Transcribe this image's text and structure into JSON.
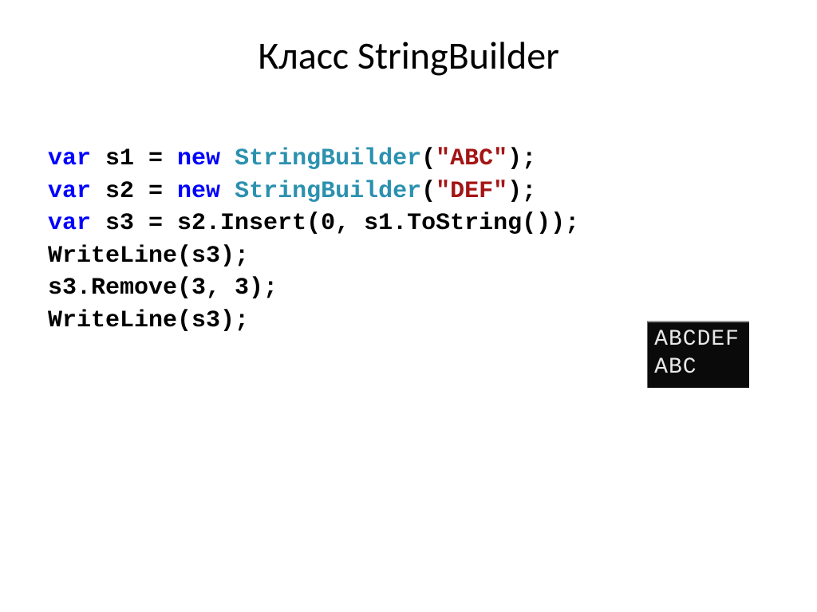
{
  "title": "Класс StringBuilder",
  "code": {
    "line1": {
      "kw_var": "var",
      "ident": " s1 = ",
      "kw_new": "new",
      "sp": " ",
      "type": "StringBuilder",
      "open": "(",
      "str": "\"ABC\"",
      "close": ");"
    },
    "line2": {
      "kw_var": "var",
      "ident": " s2 = ",
      "kw_new": "new",
      "sp": " ",
      "type": "StringBuilder",
      "open": "(",
      "str": "\"DEF\"",
      "close": ");"
    },
    "line3": {
      "kw_var": "var",
      "rest": " s3 = s2.Insert(0, s1.ToString());"
    },
    "line4": "WriteLine(s3);",
    "line5": "s3.Remove(3, 3);",
    "line6": "WriteLine(s3);"
  },
  "output": {
    "line1": "ABCDEF",
    "line2": "ABC"
  }
}
